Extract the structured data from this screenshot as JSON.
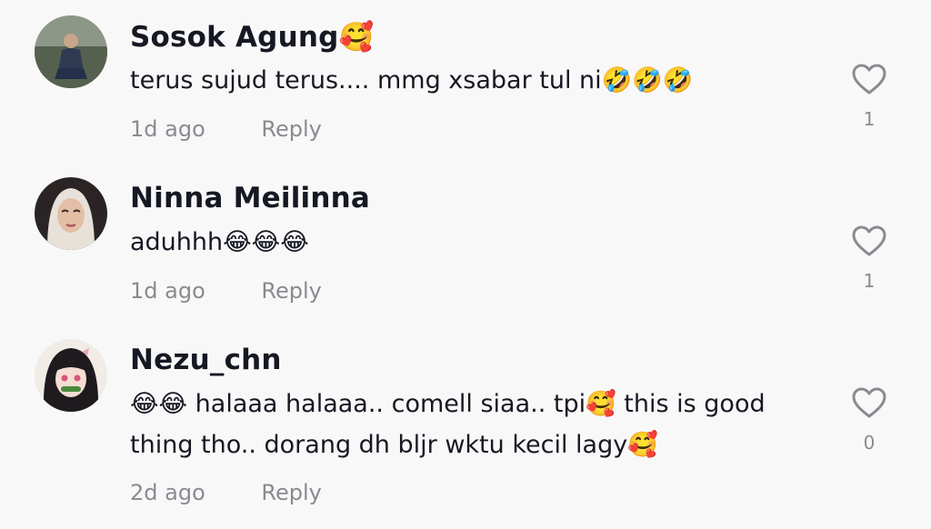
{
  "comments": [
    {
      "username": "Sosok Agung🥰",
      "text": "terus sujud terus.... mmg xsabar tul ni🤣🤣🤣",
      "time": "1d ago",
      "reply_label": "Reply",
      "likes": "1",
      "avatar_icon": "user-photo-man-crouching"
    },
    {
      "username": "Ninna Meilinna",
      "text": "aduhhh😂😂😂",
      "time": "1d ago",
      "reply_label": "Reply",
      "likes": "1",
      "avatar_icon": "user-photo-woman-hijab"
    },
    {
      "username": "Nezu_chn",
      "text": "😂😂 halaaa halaaa.. comell siaa.. tpi🥰 this is good thing tho.. dorang dh bljr wktu kecil lagy🥰",
      "time": "2d ago",
      "reply_label": "Reply",
      "likes": "0",
      "avatar_icon": "anime-girl-avatar"
    }
  ],
  "colors": {
    "background": "#f8f8f8",
    "username": "#161823",
    "meta": "#8a8b91",
    "heart_outline": "#8a8b91"
  }
}
